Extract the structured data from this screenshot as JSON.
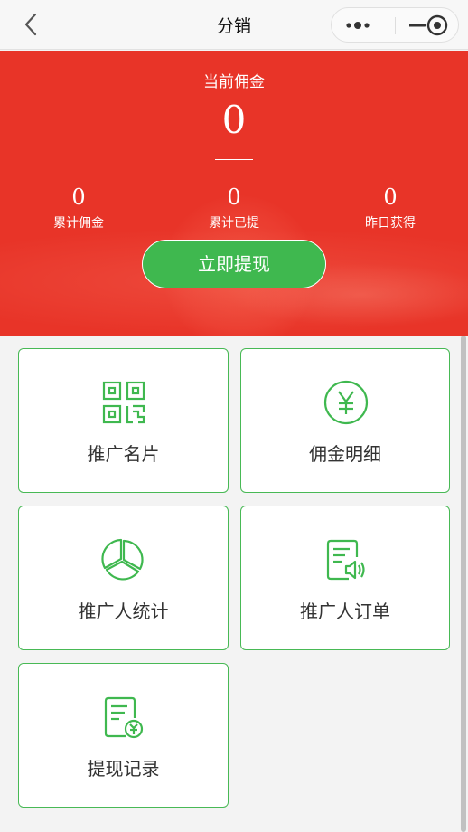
{
  "nav": {
    "title": "分销"
  },
  "banner": {
    "current_label": "当前佣金",
    "current_value": "0",
    "stats": [
      {
        "value": "0",
        "label": "累计佣金"
      },
      {
        "value": "0",
        "label": "累计已提"
      },
      {
        "value": "0",
        "label": "昨日获得"
      }
    ],
    "withdraw_button": "立即提现"
  },
  "menu": [
    {
      "label": "推广名片",
      "icon": "qr-code-icon"
    },
    {
      "label": "佣金明细",
      "icon": "yuan-circle-icon"
    },
    {
      "label": "推广人统计",
      "icon": "pie-chart-icon"
    },
    {
      "label": "推广人订单",
      "icon": "order-doc-icon"
    },
    {
      "label": "提现记录",
      "icon": "withdraw-record-icon"
    }
  ],
  "colors": {
    "banner_red": "#e83428",
    "accent_green": "#3fb84f",
    "card_border": "#48b955"
  }
}
